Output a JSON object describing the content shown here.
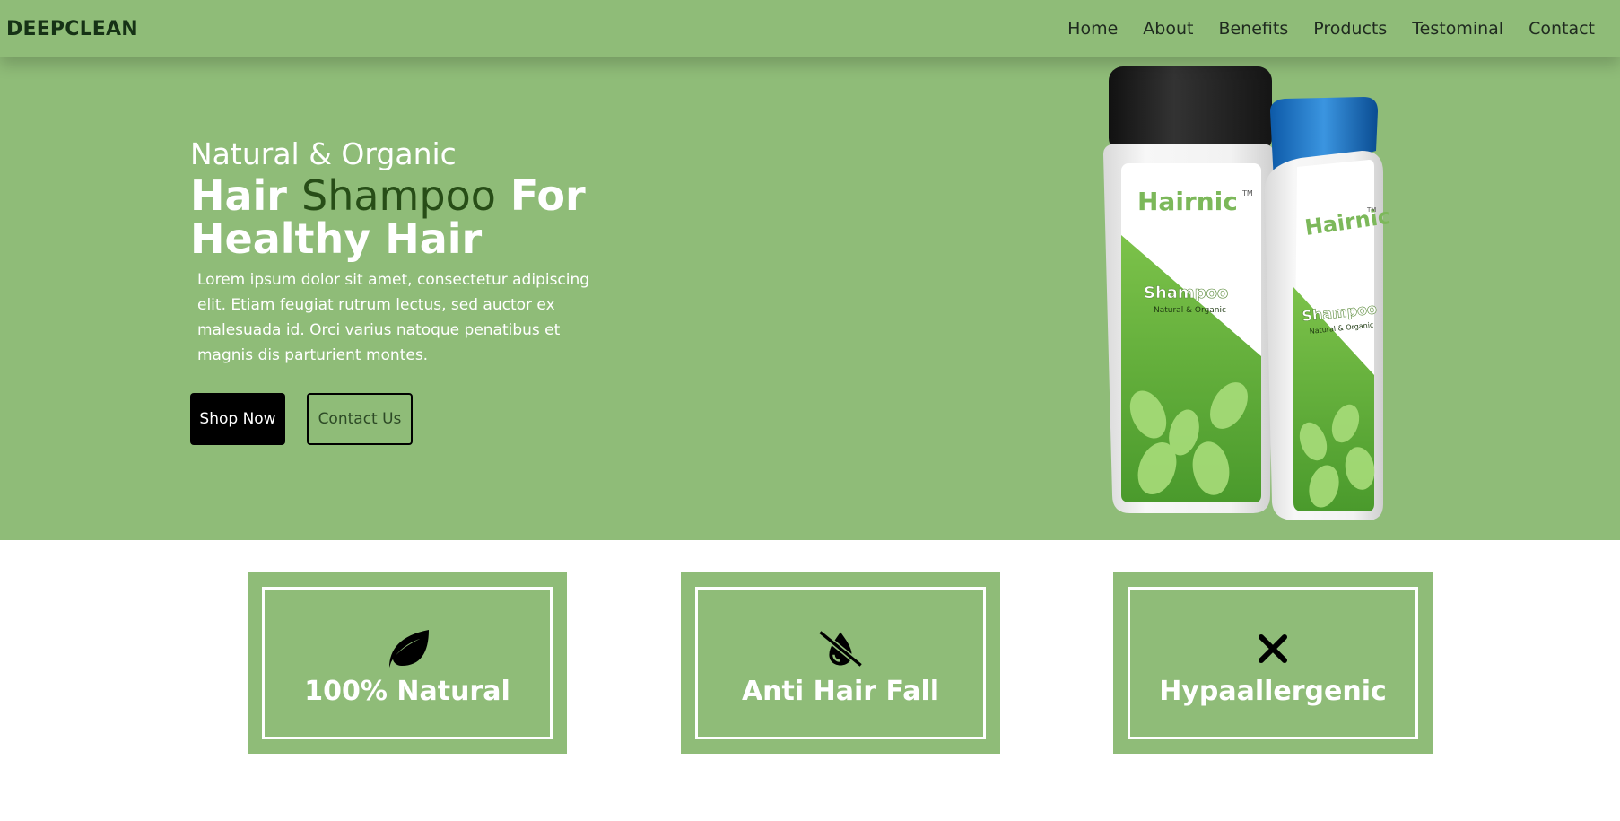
{
  "brand": "DEEPCLEAN",
  "nav": {
    "items": [
      {
        "label": "Home"
      },
      {
        "label": "About"
      },
      {
        "label": "Benefits"
      },
      {
        "label": "Products"
      },
      {
        "label": "Testominal"
      },
      {
        "label": "Contact"
      }
    ]
  },
  "hero": {
    "subtitle": "Natural & Organic",
    "headline_part1": "Hair ",
    "headline_accent": "Shampoo",
    "headline_part2": " For Healthy Hair",
    "description": "Lorem ipsum dolor sit amet, consectetur adipiscing elit. Etiam feugiat rutrum lectus, sed auctor ex malesuada id. Orci varius natoque penatibus et magnis dis parturient montes.",
    "shop_button": "Shop Now",
    "contact_button": "Contact Us"
  },
  "product": {
    "brand_label": "Hairnic",
    "trademark": "TM",
    "type_label": "Shampoo",
    "type_sublabel": "Natural & Organic"
  },
  "features": [
    {
      "title": "100% Natural",
      "icon": "leaf-icon"
    },
    {
      "title": "Anti Hair Fall",
      "icon": "no-drop-icon"
    },
    {
      "title": "Hypaallergenic",
      "icon": "x-icon"
    }
  ],
  "colors": {
    "primary_green": "#8fbc78",
    "dark_green": "#274d17",
    "brand_text": "#163216",
    "white": "#ffffff",
    "black": "#000000"
  }
}
